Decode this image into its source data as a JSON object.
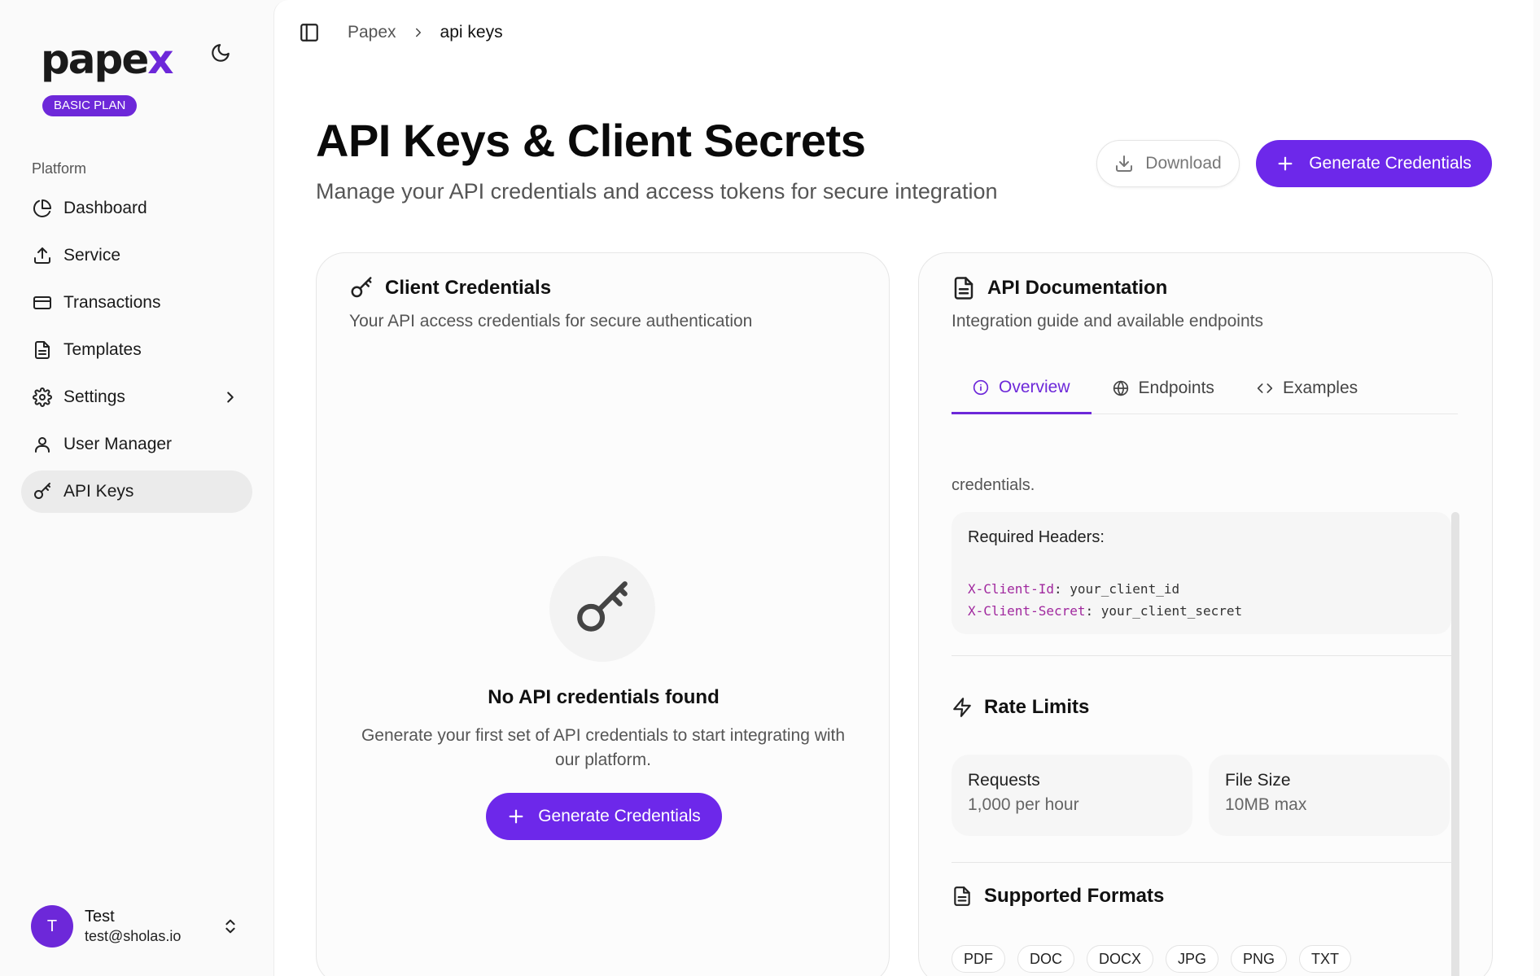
{
  "app": {
    "logo_main": "pape",
    "logo_accent": "x",
    "plan_badge": "BASIC PLAN"
  },
  "sidebar": {
    "section_label": "Platform",
    "items": [
      {
        "label": "Dashboard",
        "icon": "pie-chart-icon"
      },
      {
        "label": "Service",
        "icon": "upload-icon"
      },
      {
        "label": "Transactions",
        "icon": "credit-card-icon"
      },
      {
        "label": "Templates",
        "icon": "file-text-icon"
      },
      {
        "label": "Settings",
        "icon": "gear-icon"
      },
      {
        "label": "User Manager",
        "icon": "user-icon"
      },
      {
        "label": "API Keys",
        "icon": "key-icon",
        "active": true
      }
    ],
    "user": {
      "initial": "T",
      "name": "Test",
      "email": "test@sholas.io"
    }
  },
  "breadcrumb": {
    "root": "Papex",
    "current": "api keys"
  },
  "header": {
    "title": "API Keys & Client Secrets",
    "subtitle": "Manage your API credentials and access tokens for secure integration",
    "download_label": "Download",
    "generate_label": "Generate Credentials"
  },
  "credentials_card": {
    "title": "Client Credentials",
    "description": "Your API access credentials for secure authentication",
    "empty_title": "No API credentials found",
    "empty_description": "Generate your first set of API credentials to start integrating with our platform.",
    "button_label": "Generate Credentials"
  },
  "docs_card": {
    "title": "API Documentation",
    "description": "Integration guide and available endpoints",
    "tabs": [
      {
        "label": "Overview",
        "icon": "info-icon",
        "active": true
      },
      {
        "label": "Endpoints",
        "icon": "globe-icon"
      },
      {
        "label": "Examples",
        "icon": "code-icon"
      }
    ],
    "overview_text_tail": "credentials.",
    "headers_title": "Required Headers:",
    "headers": [
      {
        "key": "X-Client-Id",
        "value": "your_client_id"
      },
      {
        "key": "X-Client-Secret",
        "value": "your_client_secret"
      }
    ],
    "rate_limits_title": "Rate Limits",
    "rate_limits": [
      {
        "label": "Requests",
        "value": "1,000 per hour"
      },
      {
        "label": "File Size",
        "value": "10MB max"
      }
    ],
    "formats_title": "Supported Formats",
    "formats": [
      "PDF",
      "DOC",
      "DOCX",
      "JPG",
      "PNG",
      "TXT"
    ]
  },
  "colors": {
    "accent": "#6d28ea",
    "code_key": "#a0279e"
  }
}
